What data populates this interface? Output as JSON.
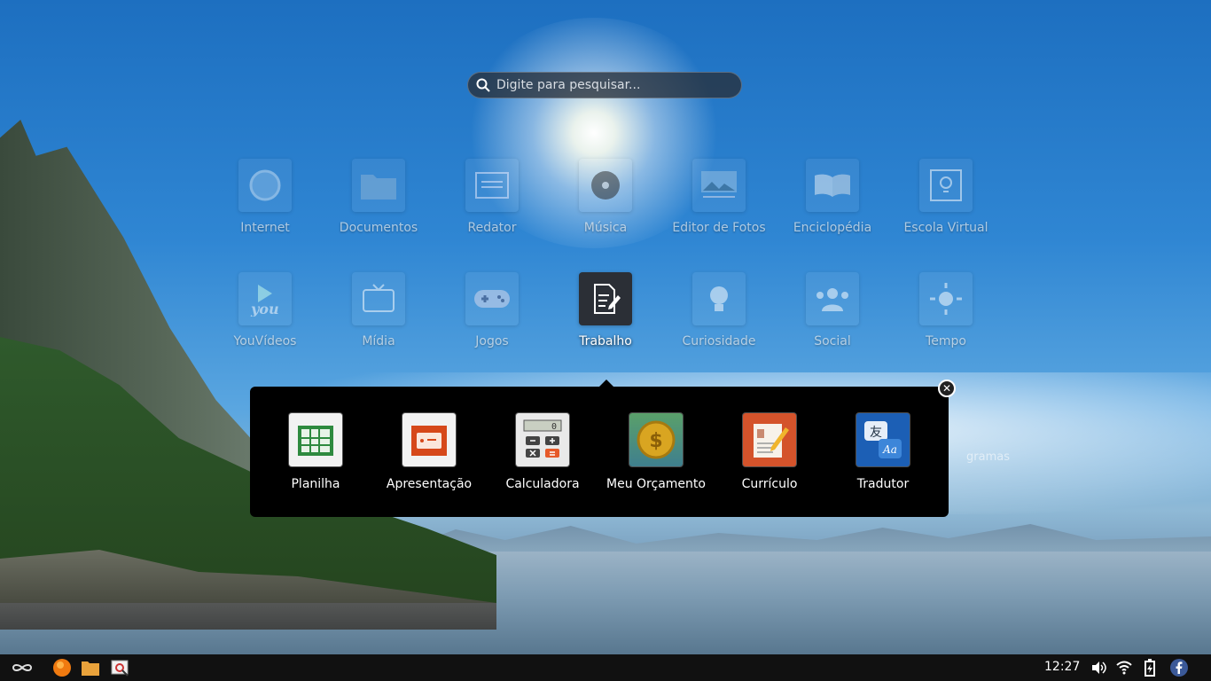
{
  "search": {
    "placeholder": "Digite para pesquisar..."
  },
  "apps": [
    {
      "label": "Internet",
      "icon": "globe-icon"
    },
    {
      "label": "Documentos",
      "icon": "folder-icon"
    },
    {
      "label": "Redator",
      "icon": "document-icon"
    },
    {
      "label": "Música",
      "icon": "music-disc-icon"
    },
    {
      "label": "Editor de Fotos",
      "icon": "photo-editor-icon"
    },
    {
      "label": "Enciclopédia",
      "icon": "book-icon"
    },
    {
      "label": "Escola Virtual",
      "icon": "lightbulb-screen-icon"
    },
    {
      "label": "YouVídeos",
      "icon": "video-play-icon"
    },
    {
      "label": "Mídia",
      "icon": "tv-icon"
    },
    {
      "label": "Jogos",
      "icon": "gamepad-icon"
    },
    {
      "label": "Trabalho",
      "icon": "edit-document-icon"
    },
    {
      "label": "Curiosidade",
      "icon": "lightbulb-icon"
    },
    {
      "label": "Social",
      "icon": "people-icon"
    },
    {
      "label": "Tempo",
      "icon": "sun-icon"
    }
  ],
  "partial_app_label": "gramas",
  "work_popup": {
    "items": [
      {
        "label": "Planilha",
        "icon": "spreadsheet-icon"
      },
      {
        "label": "Apresentação",
        "icon": "presentation-icon"
      },
      {
        "label": "Calculadora",
        "icon": "calculator-icon"
      },
      {
        "label": "Meu Orçamento",
        "icon": "coin-icon"
      },
      {
        "label": "Currículo",
        "icon": "resume-icon"
      },
      {
        "label": "Tradutor",
        "icon": "translator-icon"
      }
    ],
    "calc_display": "0",
    "translator_glyph_top": "友",
    "translator_glyph_bottom": "Aa"
  },
  "taskbar": {
    "clock": "12:27"
  },
  "colors": {
    "accent": "#1d6fc0",
    "taskbar": "#111111",
    "popup": "#000000"
  }
}
